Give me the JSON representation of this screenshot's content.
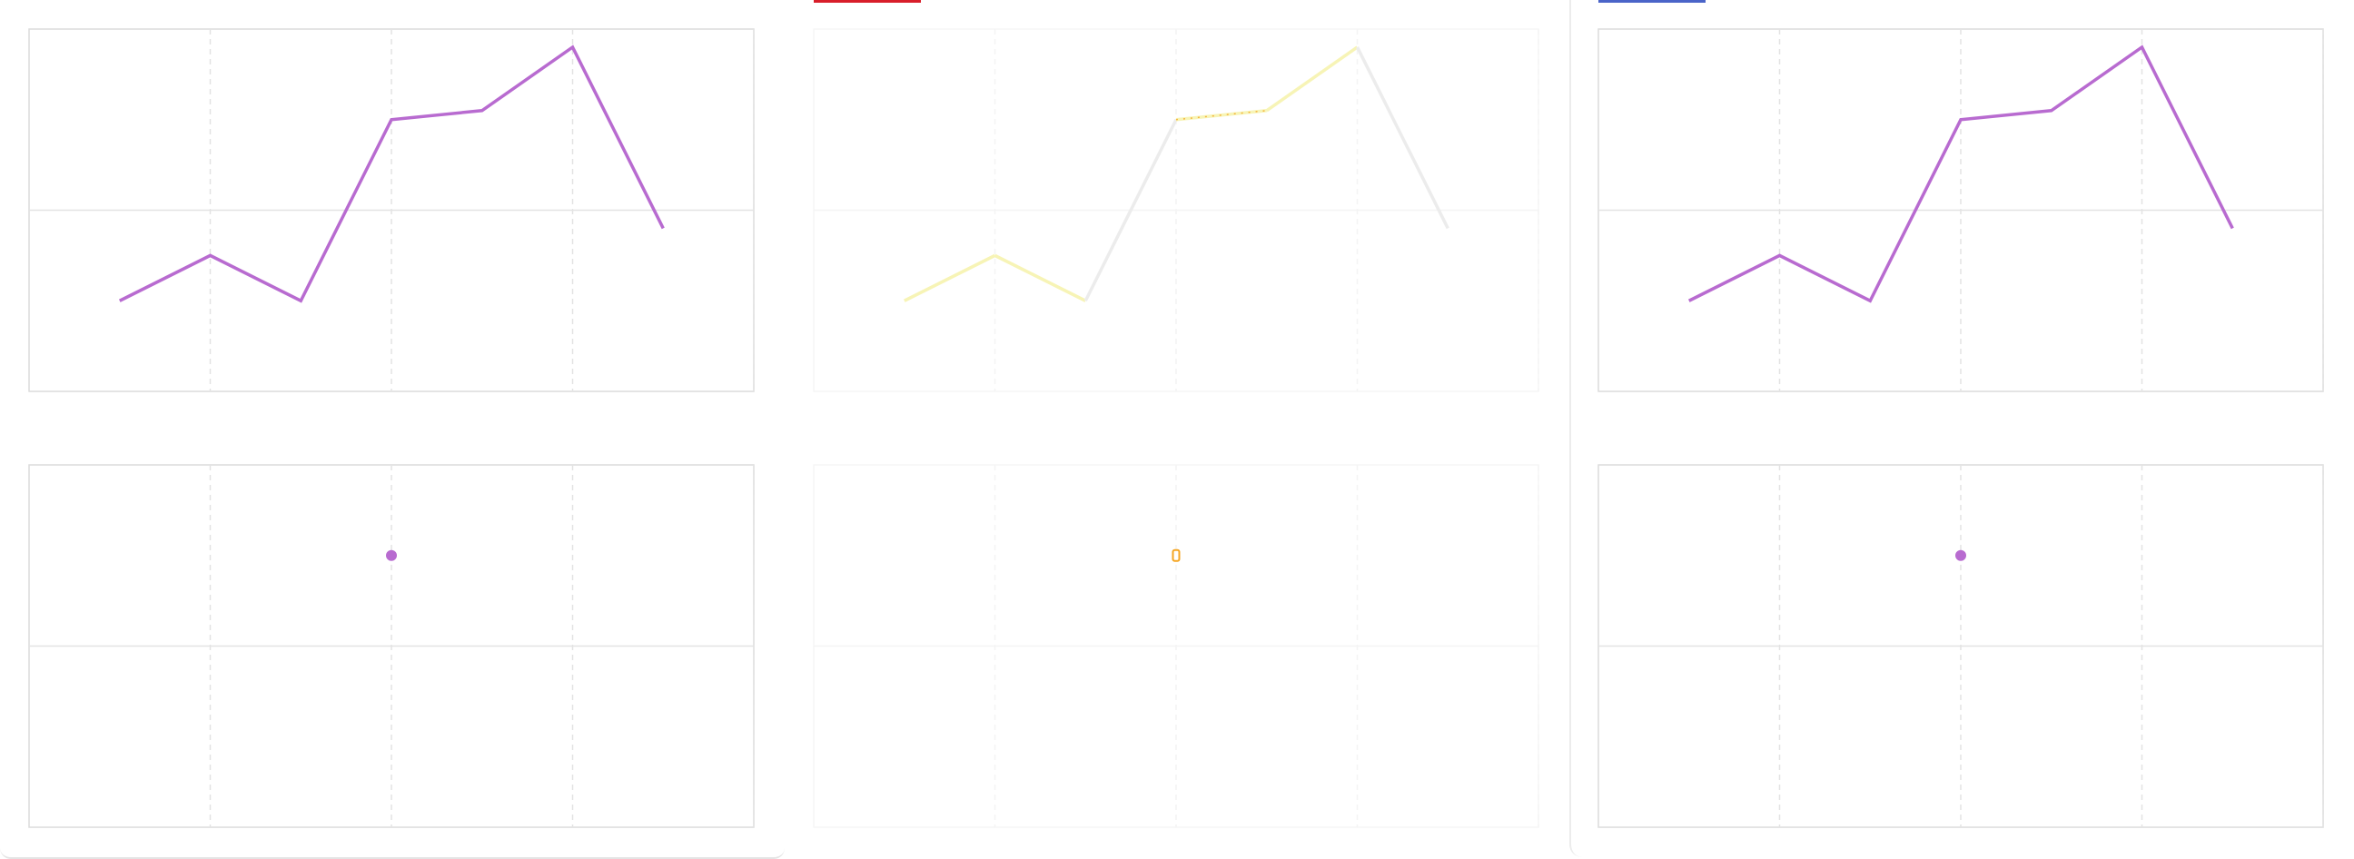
{
  "colors": {
    "line_primary": "#b86bd0",
    "line_faded": "#f7f4b6",
    "line_faded_gray": "#ececec",
    "marker_orange": "#f5a623",
    "grid": "#e3e3e3",
    "frame": "#dcdcdc",
    "accent_red": "#d81e2a",
    "accent_blue": "#4a64c8"
  },
  "panels": [
    {
      "id": "left",
      "accent": null,
      "style": "normal"
    },
    {
      "id": "middle",
      "accent": "red",
      "style": "faded"
    },
    {
      "id": "right",
      "accent": "blue",
      "style": "normal"
    }
  ],
  "chart_data": [
    {
      "type": "line",
      "panel": "left",
      "row": "top",
      "x": [
        0.5,
        1,
        1.5,
        2,
        2.5,
        3,
        3.5
      ],
      "y": [
        -0.5,
        -0.25,
        -0.5,
        0.5,
        0.55,
        0.9,
        -0.1
      ],
      "xlim": [
        0,
        4
      ],
      "ylim": [
        -1,
        1
      ],
      "grid": true
    },
    {
      "type": "scatter",
      "panel": "left",
      "row": "bottom",
      "x": [
        2
      ],
      "y": [
        0.5
      ],
      "xlim": [
        0,
        4
      ],
      "ylim": [
        -1,
        1
      ],
      "grid": true
    },
    {
      "type": "line",
      "panel": "middle",
      "row": "top",
      "style": "faded",
      "x": [
        0.5,
        1,
        1.5,
        2,
        2.5,
        3,
        3.5
      ],
      "y": [
        -0.5,
        -0.25,
        -0.5,
        0.5,
        0.55,
        0.9,
        -0.1
      ],
      "xlim": [
        0,
        4
      ],
      "ylim": [
        -1,
        1
      ],
      "grid": true,
      "highlight_segment": [
        2,
        2.5
      ]
    },
    {
      "type": "scatter",
      "panel": "middle",
      "row": "bottom",
      "style": "faded",
      "x": [
        2
      ],
      "y": [
        0.5
      ],
      "xlim": [
        0,
        4
      ],
      "ylim": [
        -1,
        1
      ],
      "grid": true
    },
    {
      "type": "line",
      "panel": "right",
      "row": "top",
      "x": [
        0.5,
        1,
        1.5,
        2,
        2.5,
        3,
        3.5
      ],
      "y": [
        -0.5,
        -0.25,
        -0.5,
        0.5,
        0.55,
        0.9,
        -0.1
      ],
      "xlim": [
        0,
        4
      ],
      "ylim": [
        -1,
        1
      ],
      "grid": true
    },
    {
      "type": "scatter",
      "panel": "right",
      "row": "bottom",
      "x": [
        2
      ],
      "y": [
        0.5
      ],
      "xlim": [
        0,
        4
      ],
      "ylim": [
        -1,
        1
      ],
      "grid": true
    }
  ]
}
